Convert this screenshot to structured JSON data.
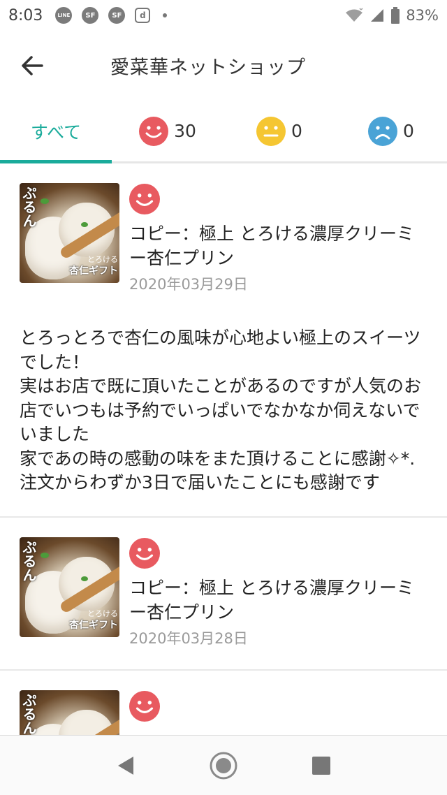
{
  "status_bar": {
    "time": "8:03",
    "notifications": [
      "LINE",
      "SF",
      "SF",
      "d"
    ],
    "battery": "83%"
  },
  "app_bar": {
    "title": "愛菜華ネットショップ"
  },
  "tabs": [
    {
      "label": "すべて",
      "active": true
    },
    {
      "icon": "happy-face-icon",
      "count": "30",
      "color": "#e85a60"
    },
    {
      "icon": "neutral-face-icon",
      "count": "0",
      "color": "#f5c632"
    },
    {
      "icon": "sad-face-icon",
      "count": "0",
      "color": "#4aa3d6"
    }
  ],
  "reviews": [
    {
      "rating": "happy",
      "thumb_text": "ぷるん",
      "thumb_label1": "とろける",
      "thumb_label2": "杏仁ギフト",
      "product_name": "コピー：極上 とろける濃厚クリーミー杏仁プリン",
      "date": "2020年03月29日",
      "body": "とろっとろで杏仁の風味が心地よい極上のスイーツでした！\n実はお店で既に頂いたことがあるのですが人気のお店でいつもは予約でいっぱいでなかなか伺えないでいました\n家であの時の感動の味をまた頂けることに感謝✧*.\n注文からわずか3日で届いたことにも感謝です"
    },
    {
      "rating": "happy",
      "thumb_text": "ぷるん",
      "thumb_label1": "とろける",
      "thumb_label2": "杏仁ギフト",
      "product_name": "コピー：極上 とろける濃厚クリーミー杏仁プリン",
      "date": "2020年03月28日",
      "body": ""
    },
    {
      "rating": "happy",
      "thumb_text": "ぷるん",
      "product_name": "",
      "date": "",
      "body": ""
    }
  ],
  "colors": {
    "accent": "#1aab9b",
    "happy": "#e85a60",
    "neutral": "#f5c632",
    "sad": "#4aa3d6"
  }
}
